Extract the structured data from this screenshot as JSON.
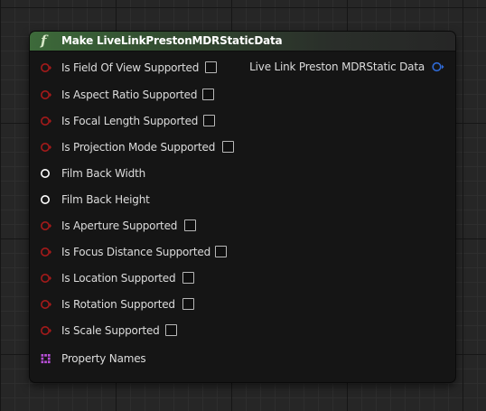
{
  "node": {
    "title": "Make LiveLinkPrestonMDRStaticData",
    "header_icon": "function-icon",
    "output": {
      "label": "Live Link Preston MDRStatic Data",
      "pin_color": "#2f6bd8"
    },
    "inputs": [
      {
        "label": "Is Field Of View Supported",
        "pin_type": "bool",
        "pin_color": "#a51a1a",
        "checked": false
      },
      {
        "label": "Is Aspect Ratio Supported",
        "pin_type": "bool",
        "pin_color": "#a51a1a",
        "checked": false
      },
      {
        "label": "Is Focal Length Supported",
        "pin_type": "bool",
        "pin_color": "#a51a1a",
        "checked": false
      },
      {
        "label": "Is Projection Mode Supported",
        "pin_type": "bool",
        "pin_color": "#a51a1a",
        "checked": false
      },
      {
        "label": "Film Back Width",
        "pin_type": "float",
        "pin_color": "#ffffff"
      },
      {
        "label": "Film Back Height",
        "pin_type": "float",
        "pin_color": "#ffffff"
      },
      {
        "label": "Is Aperture Supported",
        "pin_type": "bool",
        "pin_color": "#a51a1a",
        "checked": false
      },
      {
        "label": "Is Focus Distance Supported",
        "pin_type": "bool",
        "pin_color": "#a51a1a",
        "checked": false
      },
      {
        "label": "Is Location Supported",
        "pin_type": "bool",
        "pin_color": "#a51a1a",
        "checked": false
      },
      {
        "label": "Is Rotation Supported",
        "pin_type": "bool",
        "pin_color": "#a51a1a",
        "checked": false
      },
      {
        "label": "Is Scale Supported",
        "pin_type": "bool",
        "pin_color": "#a51a1a",
        "checked": false
      },
      {
        "label": "Property Names",
        "pin_type": "name-array",
        "pin_color": "#b84fd8"
      }
    ]
  }
}
